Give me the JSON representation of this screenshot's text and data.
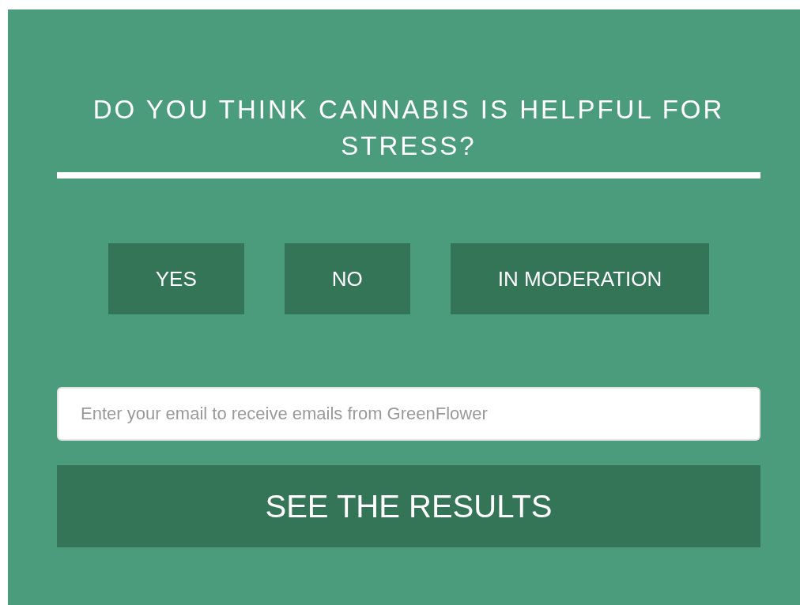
{
  "question": "DO YOU THINK CANNABIS IS HELPFUL FOR STRESS?",
  "options": [
    {
      "label": "YES",
      "selected": false
    },
    {
      "label": "NO",
      "selected": false
    },
    {
      "label": "IN MODERATION",
      "selected": false
    }
  ],
  "email": {
    "placeholder": "Enter your email to receive emails from GreenFlower"
  },
  "submit": "SEE THE RESULTS"
}
